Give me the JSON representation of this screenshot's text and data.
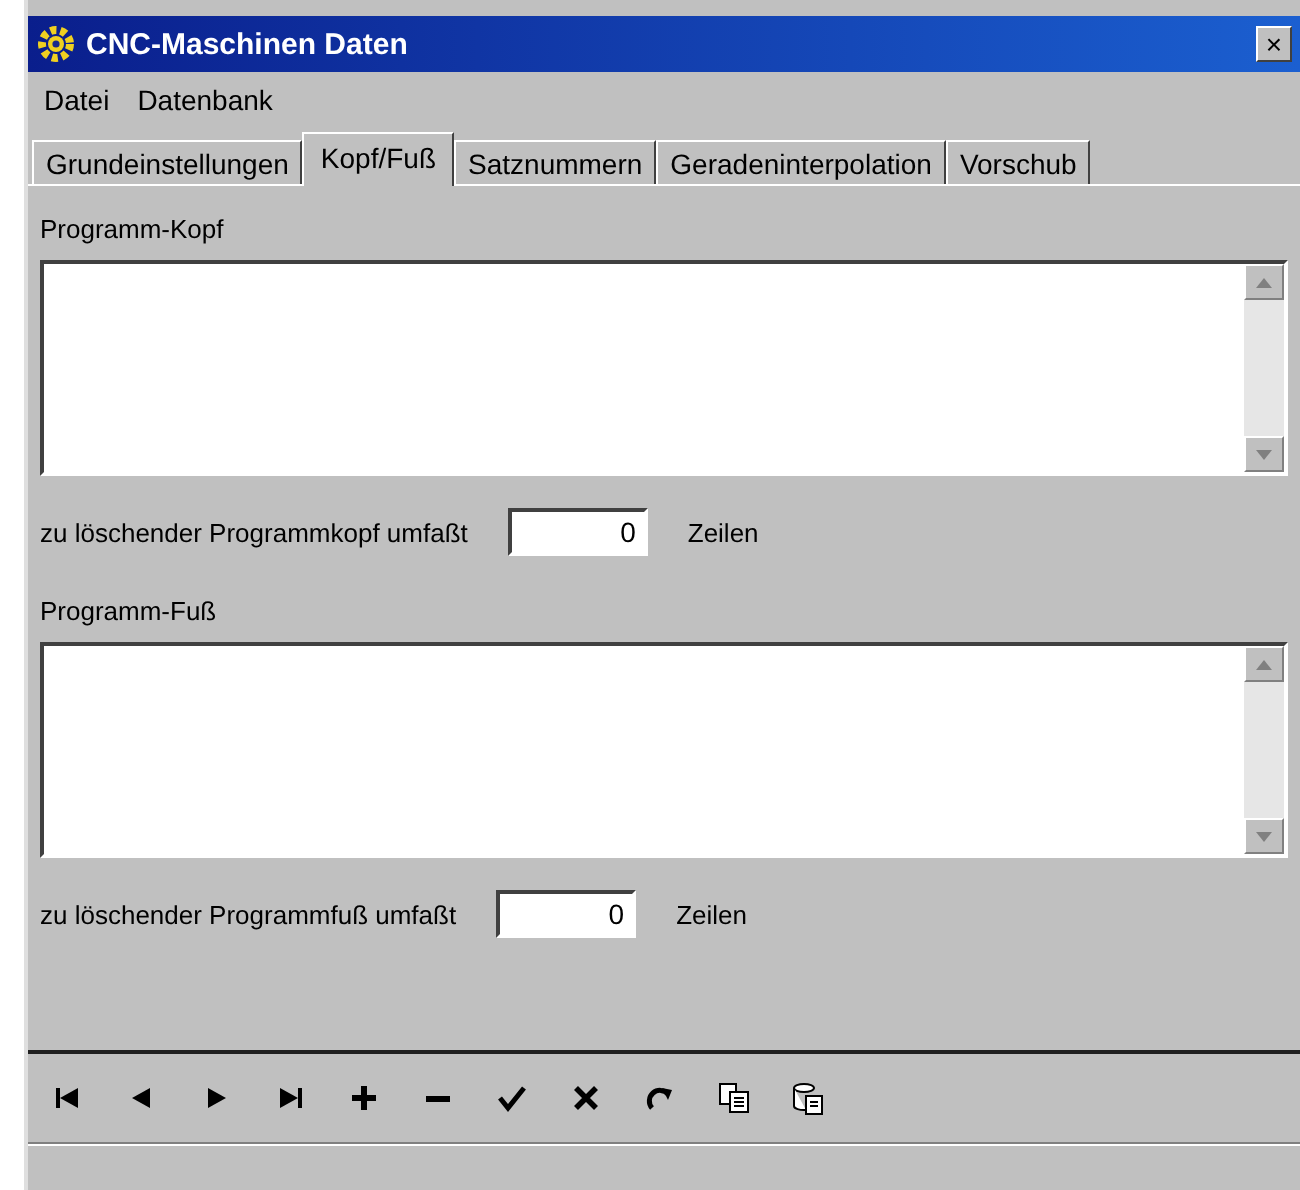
{
  "window": {
    "title": "CNC-Maschinen Daten",
    "close_button": "×"
  },
  "menu": [
    "Datei",
    "Datenbank"
  ],
  "tabs": [
    {
      "label": "Grundeinstellungen",
      "selected": false
    },
    {
      "label": "Kopf/Fuß",
      "selected": true
    },
    {
      "label": "Satznummern",
      "selected": false
    },
    {
      "label": "Geradeninterpolation",
      "selected": false
    },
    {
      "label": "Vorschub",
      "selected": false
    }
  ],
  "sections": [
    {
      "label": "Programm-Kopf",
      "delete_label": "zu löschender Programmkopf umfaßt",
      "delete_value": "0",
      "unit": "Zeilen"
    },
    {
      "label": "Programm-Fuß",
      "delete_label": "zu löschender Programmfuß umfaßt",
      "delete_value": "0",
      "unit": "Zeilen"
    }
  ],
  "toolbar": [
    {
      "kind": "first"
    },
    {
      "kind": "prev"
    },
    {
      "kind": "next"
    },
    {
      "kind": "last"
    },
    {
      "kind": "add"
    },
    {
      "kind": "remove"
    },
    {
      "kind": "confirm"
    },
    {
      "kind": "cancel"
    },
    {
      "kind": "refresh"
    },
    {
      "kind": "copy"
    },
    {
      "kind": "paste"
    }
  ]
}
